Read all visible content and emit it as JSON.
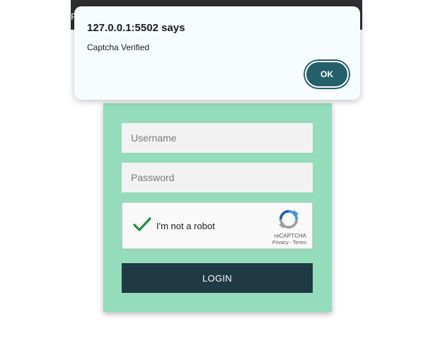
{
  "browser": {
    "partial_char": "R"
  },
  "alert": {
    "title": "127.0.0.1:5502 says",
    "message": "Captcha Verified",
    "ok_label": "OK"
  },
  "login": {
    "username_placeholder": "Username",
    "password_placeholder": "Password",
    "recaptcha": {
      "label": "I'm not a robot",
      "checked": true,
      "brand": "reCAPTCHA",
      "links": "Privacy - Terms"
    },
    "login_label": "LOGIN"
  },
  "colors": {
    "card_background": "#95dcbc",
    "login_button": "#1f3a42",
    "ok_button": "#25606a",
    "checkmark": "#1e8e3e"
  }
}
